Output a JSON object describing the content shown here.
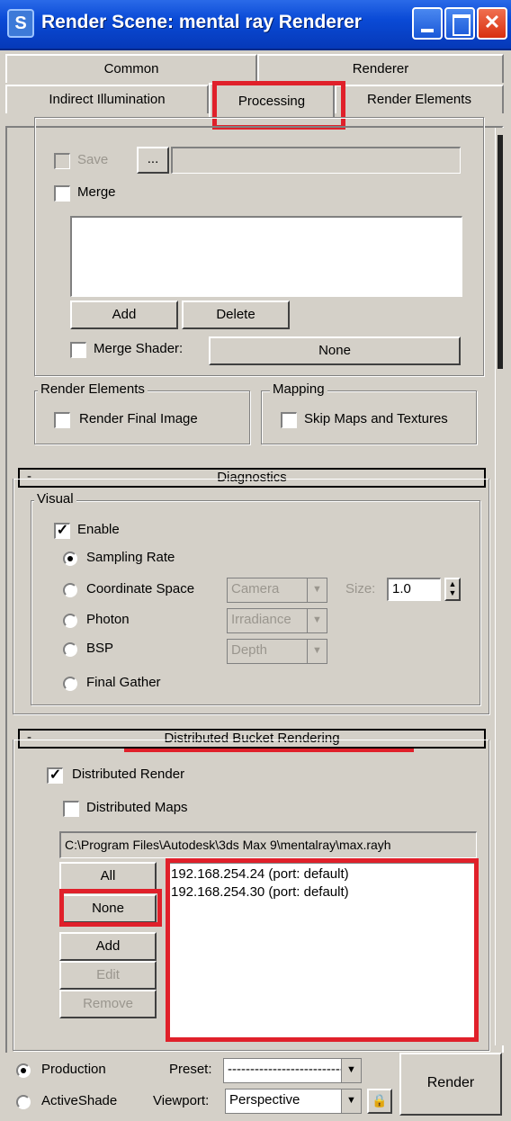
{
  "window": {
    "title": "Render Scene: mental ray Renderer",
    "icon_glyph": "S"
  },
  "tabs": [
    {
      "label": "Common"
    },
    {
      "label": "Renderer"
    },
    {
      "label": "Indirect Illumination"
    },
    {
      "label": "Processing",
      "active": true
    },
    {
      "label": "Render Elements"
    }
  ],
  "render_passes": {
    "save_label": "Save",
    "browse_label": "...",
    "merge_label": "Merge",
    "add_label": "Add",
    "delete_label": "Delete",
    "merge_shader_label": "Merge Shader:",
    "merge_shader_value": "None"
  },
  "render_elements_group": {
    "title": "Render Elements",
    "render_final_image_label": "Render Final Image"
  },
  "mapping_group": {
    "title": "Mapping",
    "skip_maps_label": "Skip Maps and Textures"
  },
  "diagnostics": {
    "title": "Diagnostics",
    "collapse_glyph": "-",
    "visual_title": "Visual",
    "enable_label": "Enable",
    "enable_checked": true,
    "options": [
      {
        "label": "Sampling Rate",
        "selected": true
      },
      {
        "label": "Coordinate Space",
        "selected": false
      },
      {
        "label": "Photon",
        "selected": false
      },
      {
        "label": "BSP",
        "selected": false
      },
      {
        "label": "Final Gather",
        "selected": false
      }
    ],
    "coordinate_value": "Camera",
    "photon_value": "Irradiance",
    "bsp_value": "Depth",
    "size_label": "Size:",
    "size_value": "1.0"
  },
  "dbr": {
    "title": "Distributed Bucket Rendering",
    "collapse_glyph": "-",
    "distributed_render_label": "Distributed Render",
    "distributed_render_checked": true,
    "distributed_maps_label": "Distributed Maps",
    "path": "C:\\Program Files\\Autodesk\\3ds Max 9\\mentalray\\max.rayh",
    "all_label": "All",
    "none_label": "None",
    "add_label": "Add",
    "edit_label": "Edit",
    "remove_label": "Remove",
    "hosts": [
      "192.168.254.24 (port: default)",
      "192.168.254.30 (port: default)"
    ]
  },
  "bottom": {
    "production_label": "Production",
    "activeshade_label": "ActiveShade",
    "preset_label": "Preset:",
    "preset_value": "--------------------------",
    "viewport_label": "Viewport:",
    "viewport_value": "Perspective",
    "render_label": "Render"
  },
  "colors": {
    "title_bar": "#0a4ad6",
    "dialog_bg": "#d4d0c8",
    "highlight": "#e0202a"
  }
}
